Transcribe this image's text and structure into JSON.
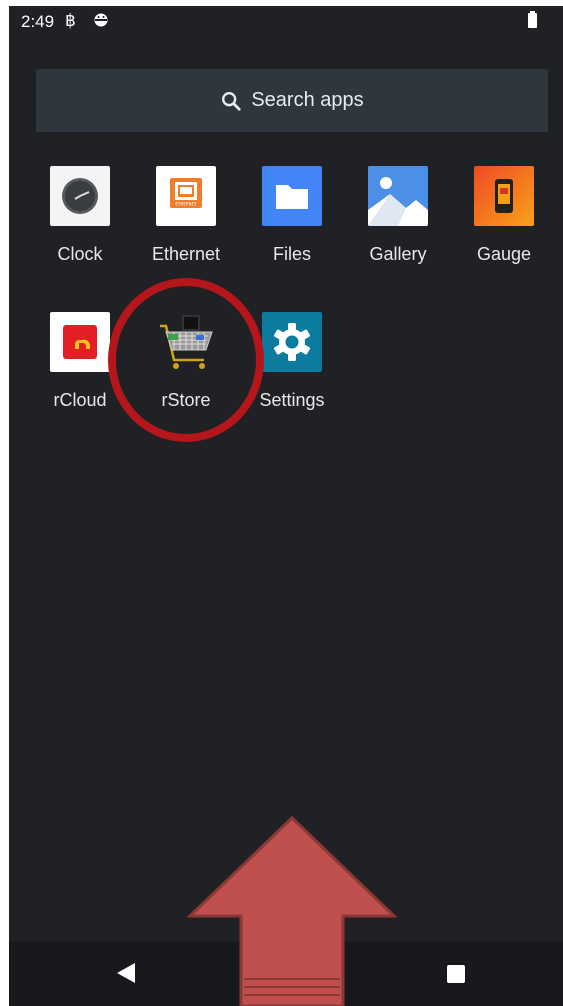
{
  "status_bar": {
    "time": "2:49",
    "icons": [
      "notification-icon",
      "android-robot-icon",
      "battery-icon"
    ]
  },
  "search": {
    "placeholder": "Search apps",
    "icon": "search-icon"
  },
  "apps": [
    {
      "label": "Clock",
      "icon": "clock-icon"
    },
    {
      "label": "Ethernet",
      "icon": "ethernet-icon",
      "icon_text": "ETHERNET"
    },
    {
      "label": "Files",
      "icon": "folder-icon"
    },
    {
      "label": "Gallery",
      "icon": "gallery-icon"
    },
    {
      "label": "Gauge",
      "icon": "gauge-icon"
    },
    {
      "label": "rCloud",
      "icon": "rcloud-icon"
    },
    {
      "label": "rStore",
      "icon": "shopping-cart-icon"
    },
    {
      "label": "Settings",
      "icon": "gear-icon"
    }
  ],
  "annotations": {
    "highlight_color": "#b4161c",
    "arrow_color": "#c0504d"
  },
  "colors": {
    "background": "#1f2124",
    "search_bar": "#30363d",
    "nav_bar": "#17191c"
  }
}
